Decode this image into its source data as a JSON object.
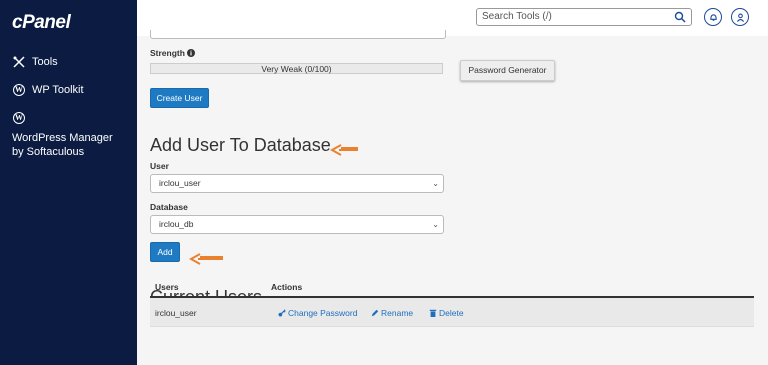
{
  "sidebar": {
    "logo": "cPanel",
    "items": [
      {
        "label": "Tools",
        "icon": "tools-icon"
      },
      {
        "label": "WP Toolkit",
        "icon": "wordpress-icon"
      },
      {
        "label": "WordPress Manager by Softaculous",
        "icon": "wordpress-icon"
      }
    ]
  },
  "topbar": {
    "search_placeholder": "Search Tools (/)"
  },
  "form": {
    "strength_label": "Strength",
    "strength_value": "Very Weak (0/100)",
    "password_generator_label": "Password Generator",
    "create_user_label": "Create User"
  },
  "add_user_section": {
    "title": "Add User To Database",
    "user_label": "User",
    "user_value": "irclou_user",
    "database_label": "Database",
    "database_value": "irclou_db",
    "add_label": "Add"
  },
  "current_users": {
    "title": "Current Users",
    "columns": [
      "Users",
      "Actions"
    ],
    "rows": [
      {
        "user": "irclou_user",
        "actions": [
          "Change Password",
          "Rename",
          "Delete"
        ]
      }
    ]
  },
  "colors": {
    "sidebar_bg": "#0b1b42",
    "accent": "#1f7ac4",
    "annotation_arrow": "#e8822e"
  }
}
